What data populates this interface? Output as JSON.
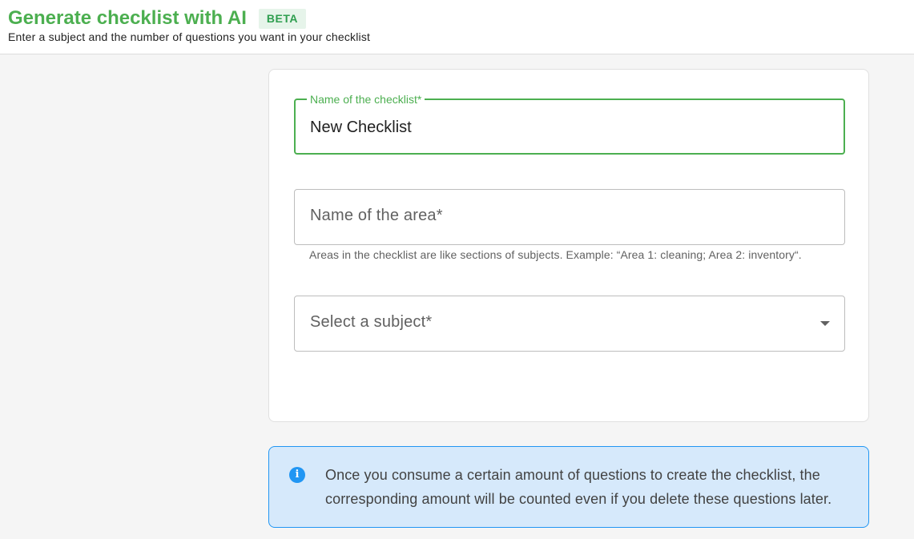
{
  "header": {
    "title": "Generate checklist with AI",
    "badge": "BETA",
    "subtitle": "Enter a subject and the number of questions you want in your checklist"
  },
  "form": {
    "checklist_name": {
      "label": "Name of the checklist*",
      "value": "New Checklist"
    },
    "area_name": {
      "placeholder": "Name of the area*",
      "helper": " Areas in the checklist are like sections of subjects. Example: “Area 1: cleaning; Area 2: inventory“."
    },
    "subject": {
      "placeholder": "Select a subject*",
      "icon": "chevron-down-icon"
    }
  },
  "info": {
    "icon": "info-icon",
    "text": "Once you consume a certain amount of questions to create the checklist, the corresponding amount will be counted even if you delete these questions later."
  },
  "colors": {
    "accent_green": "#4caf50",
    "info_blue": "#2196f3",
    "info_background": "#d6e9fb"
  }
}
